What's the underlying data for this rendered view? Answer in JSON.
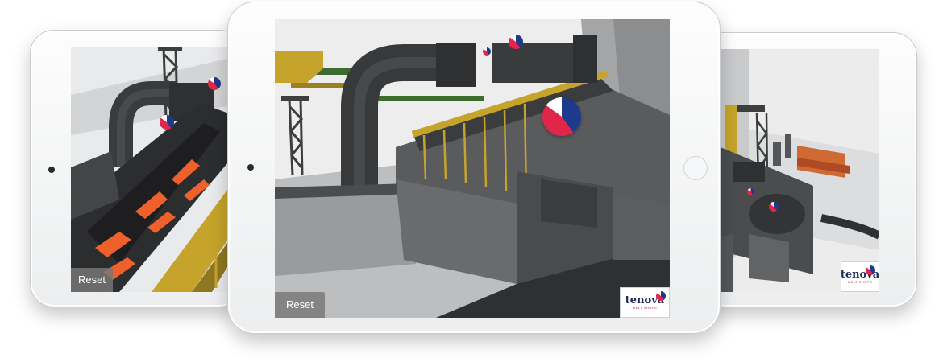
{
  "ui": {
    "reset_label": "Reset",
    "brand": "tenova",
    "brand_subtitle": "MELT SHOPS"
  },
  "colors": {
    "steel_dark": "#3b3c3e",
    "steel_mid": "#5a5b5d",
    "beam_yellow": "#c6a32a",
    "beam_green": "#3e6b2f",
    "molten": "#f0602a",
    "hotspot_red": "#e2264b",
    "hotspot_blue": "#1d3b8b"
  },
  "icons": [
    "hotspot-marker-icon",
    "tenova-logo-icon",
    "camera-icon",
    "home-button-icon"
  ]
}
